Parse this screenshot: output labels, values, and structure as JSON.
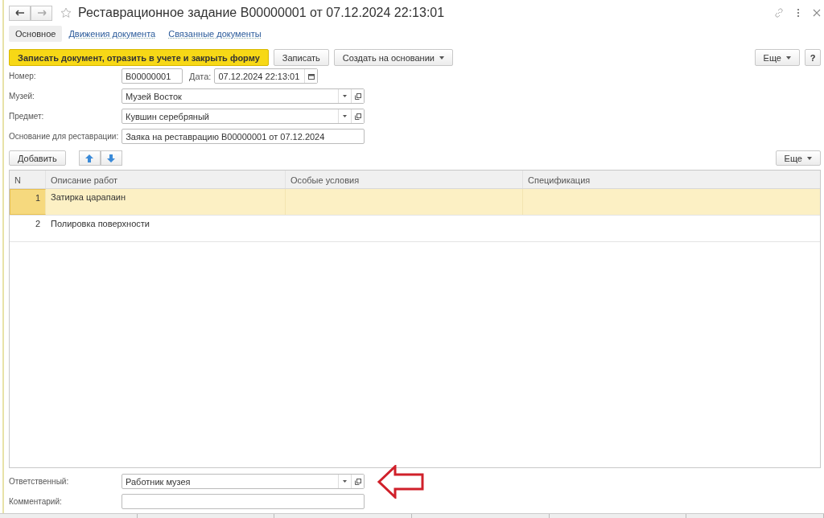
{
  "window": {
    "title": "Реставрационное задание В00000001 от 07.12.2024 22:13:01",
    "favorite": false
  },
  "tabs": [
    {
      "label": "Основное",
      "selected": true
    },
    {
      "label": "Движения документа",
      "selected": false
    },
    {
      "label": "Связанные документы",
      "selected": false
    }
  ],
  "toolbar": {
    "buttons": [
      {
        "label": "Записать документ, отразить в учете и закрыть форму",
        "kind": "primary"
      },
      {
        "label": "Записать",
        "kind": "plain"
      },
      {
        "label": "Создать на основании",
        "kind": "dropdown"
      }
    ],
    "more": "Еще",
    "help": "?"
  },
  "header_fields": {
    "number": {
      "label": "Номер:",
      "value": "В00000001"
    },
    "date": {
      "label": "Дата:",
      "value": "07.12.2024 22:13:01"
    },
    "rows": [
      {
        "label": "Музей:",
        "value": "Музей Восток",
        "kind": "ref"
      },
      {
        "label": "Предмет:",
        "value": "Кувшин серебряный",
        "kind": "ref"
      },
      {
        "label": "Основание для реставрации:",
        "value": "Заяка на реставрацию В00000001 от 07.12.2024",
        "kind": "text"
      }
    ]
  },
  "table": {
    "add_button": "Добавить",
    "more": "Еще",
    "columns": [
      "N",
      "Описание работ",
      "Особые условия",
      "Спецификация"
    ],
    "rows": [
      {
        "cells": [
          "1",
          "Затирка царапаин",
          "",
          ""
        ],
        "selected": true
      },
      {
        "cells": [
          "2",
          "Полировка поверхности",
          "",
          ""
        ],
        "selected": false
      }
    ]
  },
  "footer_fields": [
    {
      "label": "Ответственный:",
      "value": "Работник музея",
      "kind": "ref",
      "highlighted": true
    },
    {
      "label": "Комментарий:",
      "kind": "text",
      "highlighted": false
    }
  ]
}
